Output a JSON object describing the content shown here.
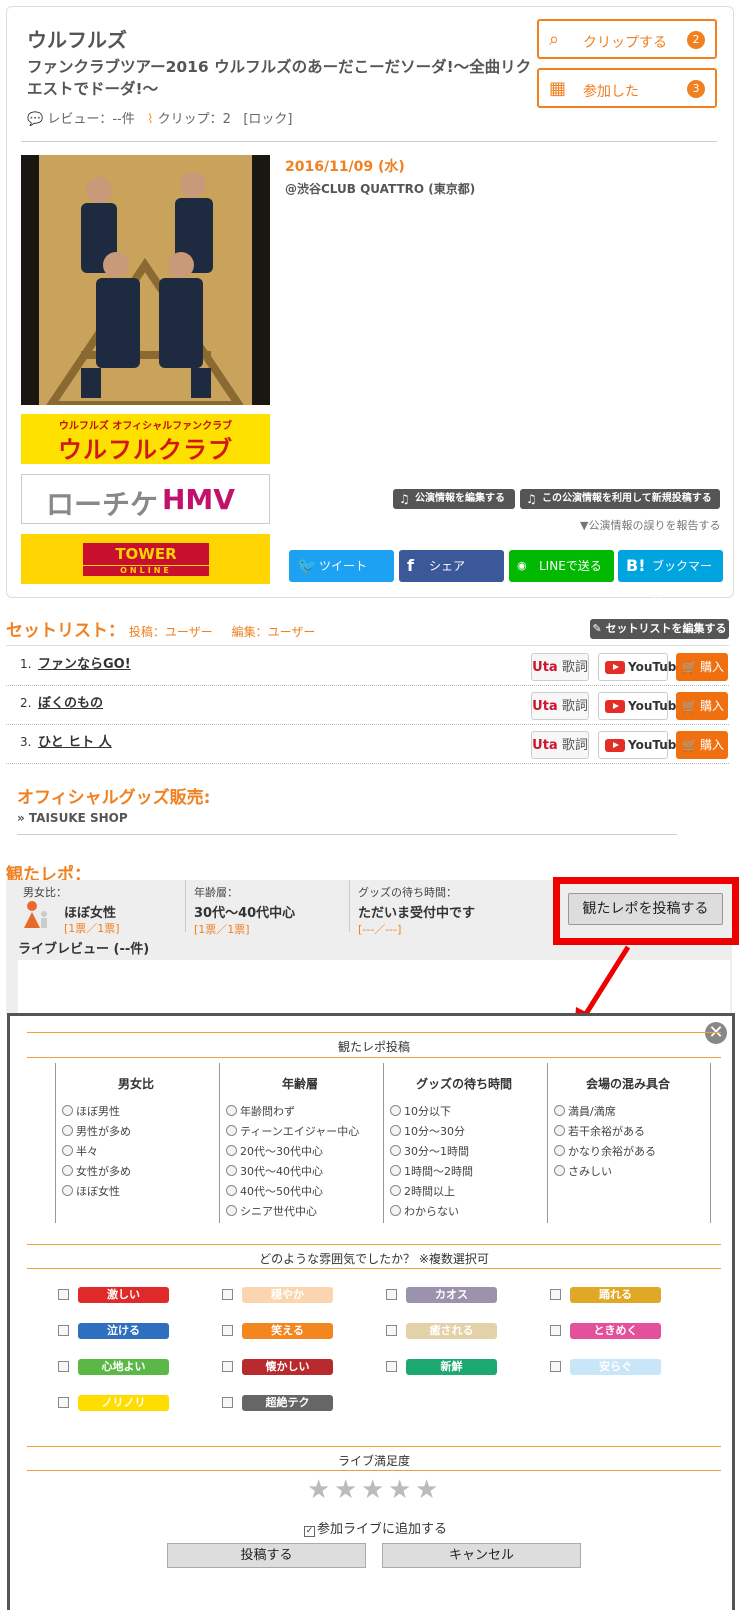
{
  "event": {
    "artist": "ウルフルズ",
    "title": "ファンクラブツアー2016 ウルフルズのあーだこーだソーダ!〜全曲リクエストでドーダ!〜",
    "review_label": "レビュー：--件",
    "clip_label": "クリップ：2",
    "genre": "[ロック]",
    "date": "2016/11/09 (水)",
    "venue": "@渋谷CLUB QUATTRO (東京都)"
  },
  "actions": {
    "clip_label": "クリップする",
    "clip_count": "2",
    "attend_label": "参加した",
    "attend_count": "3"
  },
  "banners": {
    "fanclub_top": "ウルフルズ オフィシャルファンクラブ",
    "fanclub_main": "ウルフルクラブ",
    "lawson_a": "ローチケ",
    "lawson_b": "HMV",
    "tower_a": "TOWER RECORDS",
    "tower_b": "ONLINE"
  },
  "edit": {
    "edit_info": "公演情報を編集する",
    "new_post": "この公演情報を利用して新規投稿する",
    "report_error": "▼公演情報の誤りを報告する"
  },
  "share": {
    "tweet": "ツイート",
    "facebook": "シェア",
    "line": "LINEで送る",
    "hatena": "ブックマーク"
  },
  "setlist": {
    "heading": "セットリスト：",
    "poster": "投稿：ユーザー",
    "editor": "編集：ユーザー",
    "edit_button": "セットリストを編集する",
    "lyrics_a": "Uta",
    "lyrics_b": "歌詞",
    "youtube": "YouTube",
    "buy": "購入",
    "songs": [
      {
        "no": "1.",
        "name": "ファンならGO!"
      },
      {
        "no": "2.",
        "name": "ぼくのもの"
      },
      {
        "no": "3.",
        "name": "ひと ヒト 人"
      }
    ]
  },
  "goods": {
    "heading": "オフィシャルグッズ販売:",
    "shop": "» TAISUKE SHOP"
  },
  "report": {
    "heading": "観たレポ：",
    "gender_label": "男女比：",
    "gender_value": "ほぼ女性",
    "gender_votes": "[1票／1票]",
    "age_label": "年齢層：",
    "age_value": "30代〜40代中心",
    "age_votes": "[1票／1票]",
    "goods_label": "グッズの待ち時間：",
    "goods_value": "ただいま受付中です",
    "goods_votes": "[---／---]",
    "post_button": "観たレポを投稿する",
    "live_review": "ライブレビュー (--件)"
  },
  "modal": {
    "title": "観たレポ投稿",
    "columns": [
      {
        "header": "男女比",
        "options": [
          "ほぼ男性",
          "男性が多め",
          "半々",
          "女性が多め",
          "ほぼ女性"
        ]
      },
      {
        "header": "年齢層",
        "options": [
          "年齢問わず",
          "ティーンエイジャー中心",
          "20代〜30代中心",
          "30代〜40代中心",
          "40代〜50代中心",
          "シニア世代中心"
        ]
      },
      {
        "header": "グッズの待ち時間",
        "options": [
          "10分以下",
          "10分〜30分",
          "30分〜1時間",
          "1時間〜2時間",
          "2時間以上",
          "わからない"
        ]
      },
      {
        "header": "会場の混み具合",
        "options": [
          "満員/満席",
          "若干余裕がある",
          "かなり余裕がある",
          "さみしい"
        ]
      }
    ],
    "mood_question": "どのような雰囲気でしたか？ ※複数選択可",
    "moods": [
      {
        "label": "激しい",
        "color": "#e02a2a",
        "text": "#ffffff"
      },
      {
        "label": "穏やか",
        "color": "#fbd5b0",
        "text": "#ffffff"
      },
      {
        "label": "カオス",
        "color": "#9b93ad",
        "text": "#ffffff"
      },
      {
        "label": "踊れる",
        "color": "#e0a826",
        "text": "#ffffff"
      },
      {
        "label": "泣ける",
        "color": "#2f6fbf",
        "text": "#ffffff"
      },
      {
        "label": "笑える",
        "color": "#f3861f",
        "text": "#ffffff"
      },
      {
        "label": "癒される",
        "color": "#e3d2a8",
        "text": "#ffffff"
      },
      {
        "label": "ときめく",
        "color": "#e4509c",
        "text": "#ffffff"
      },
      {
        "label": "心地よい",
        "color": "#5bb847",
        "text": "#ffffff"
      },
      {
        "label": "懐かしい",
        "color": "#b82a2e",
        "text": "#ffffff"
      },
      {
        "label": "新鮮",
        "color": "#1da870",
        "text": "#ffffff"
      },
      {
        "label": "安らぐ",
        "color": "#c8e6f7",
        "text": "#ffffff"
      },
      {
        "label": "ノリノリ",
        "color": "#ffdd00",
        "text": "#ffffff"
      },
      {
        "label": "超絶テク",
        "color": "#666666",
        "text": "#ffffff"
      }
    ],
    "satisfaction": "ライブ満足度",
    "stars": "★",
    "add_live": "参加ライブに追加する",
    "submit": "投稿する",
    "cancel": "キャンセル",
    "close": "✕"
  },
  "colors": {
    "accent": "#f08020",
    "twitter": "#1da1f2",
    "facebook": "#3b5998",
    "line": "#00b900",
    "hatena": "#00a4de"
  }
}
